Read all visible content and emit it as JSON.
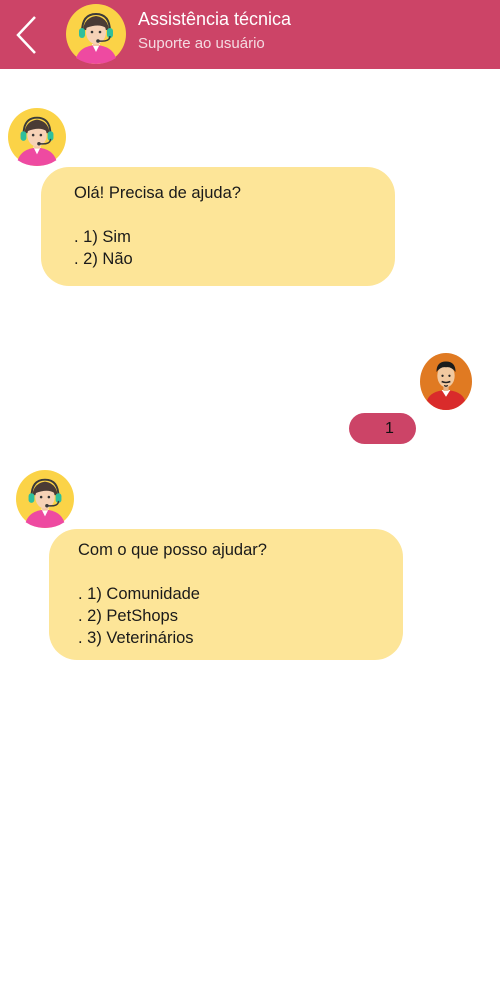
{
  "header": {
    "back_icon": "chevron-left-icon",
    "title": "Assistência técnica",
    "subtitle": "Suporte ao usuário",
    "background_color": "#cc4467"
  },
  "messages": [
    {
      "from": "agent",
      "avatar_icon": "support-agent-icon",
      "heading": "Olá! Precisa de ajuda?",
      "options": [
        ". 1) Sim",
        ". 2) Não"
      ]
    },
    {
      "from": "user",
      "avatar_icon": "user-avatar-icon",
      "text": "1"
    },
    {
      "from": "agent",
      "avatar_icon": "support-agent-icon",
      "heading": "Com o que posso ajudar?",
      "options": [
        ". 1) Comunidade",
        ". 2) PetShops",
        ". 3) Veterinários"
      ]
    }
  ],
  "colors": {
    "accent": "#cc4467",
    "bubble": "#fde598",
    "background": "#ffffff"
  }
}
